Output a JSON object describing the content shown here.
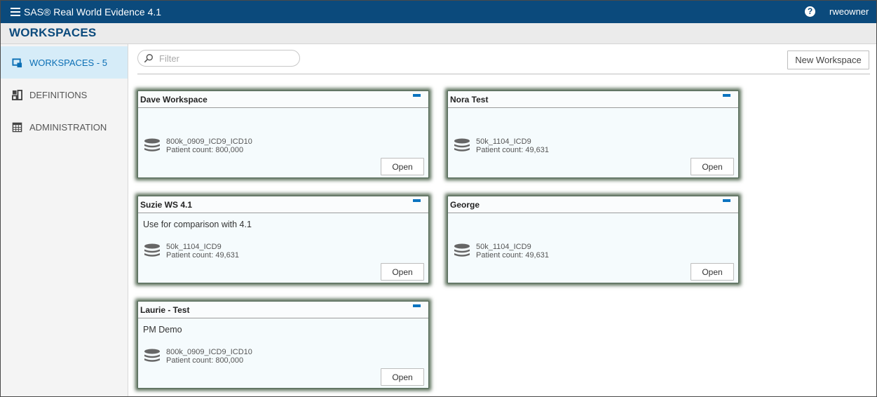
{
  "topbar": {
    "app_title": "SAS® Real World Evidence 4.1",
    "help_label": "?",
    "user": "rweowner"
  },
  "page": {
    "title": "WORKSPACES"
  },
  "sidebar": {
    "items": [
      {
        "label": "WORKSPACES - 5",
        "icon": "workspace-icon",
        "active": true
      },
      {
        "label": "DEFINITIONS",
        "icon": "definitions-icon",
        "active": false
      },
      {
        "label": "ADMINISTRATION",
        "icon": "calendar-grid-icon",
        "active": false
      }
    ]
  },
  "toolbar": {
    "filter_placeholder": "Filter",
    "new_workspace_label": "New Workspace"
  },
  "workspaces": [
    {
      "name": "Dave Workspace",
      "description": "",
      "data_source": "800k_0909_ICD9_ICD10",
      "patient_count": "Patient count: 800,000",
      "open_label": "Open"
    },
    {
      "name": "Nora Test",
      "description": "",
      "data_source": "50k_1104_ICD9",
      "patient_count": "Patient count: 49,631",
      "open_label": "Open"
    },
    {
      "name": "Suzie WS 4.1",
      "description": "Use for comparison with 4.1",
      "data_source": "50k_1104_ICD9",
      "patient_count": "Patient count: 49,631",
      "open_label": "Open"
    },
    {
      "name": "George",
      "description": "",
      "data_source": "50k_1104_ICD9",
      "patient_count": "Patient count: 49,631",
      "open_label": "Open"
    },
    {
      "name": "Laurie - Test",
      "description": "PM Demo",
      "data_source": "800k_0909_ICD9_ICD10",
      "patient_count": "Patient count: 800,000",
      "open_label": "Open"
    }
  ],
  "colors": {
    "topbar": "#0b4a7c",
    "accent": "#0b6fb5",
    "sidebar_active": "#d6ecf8",
    "card_shadow": "#566b55"
  }
}
